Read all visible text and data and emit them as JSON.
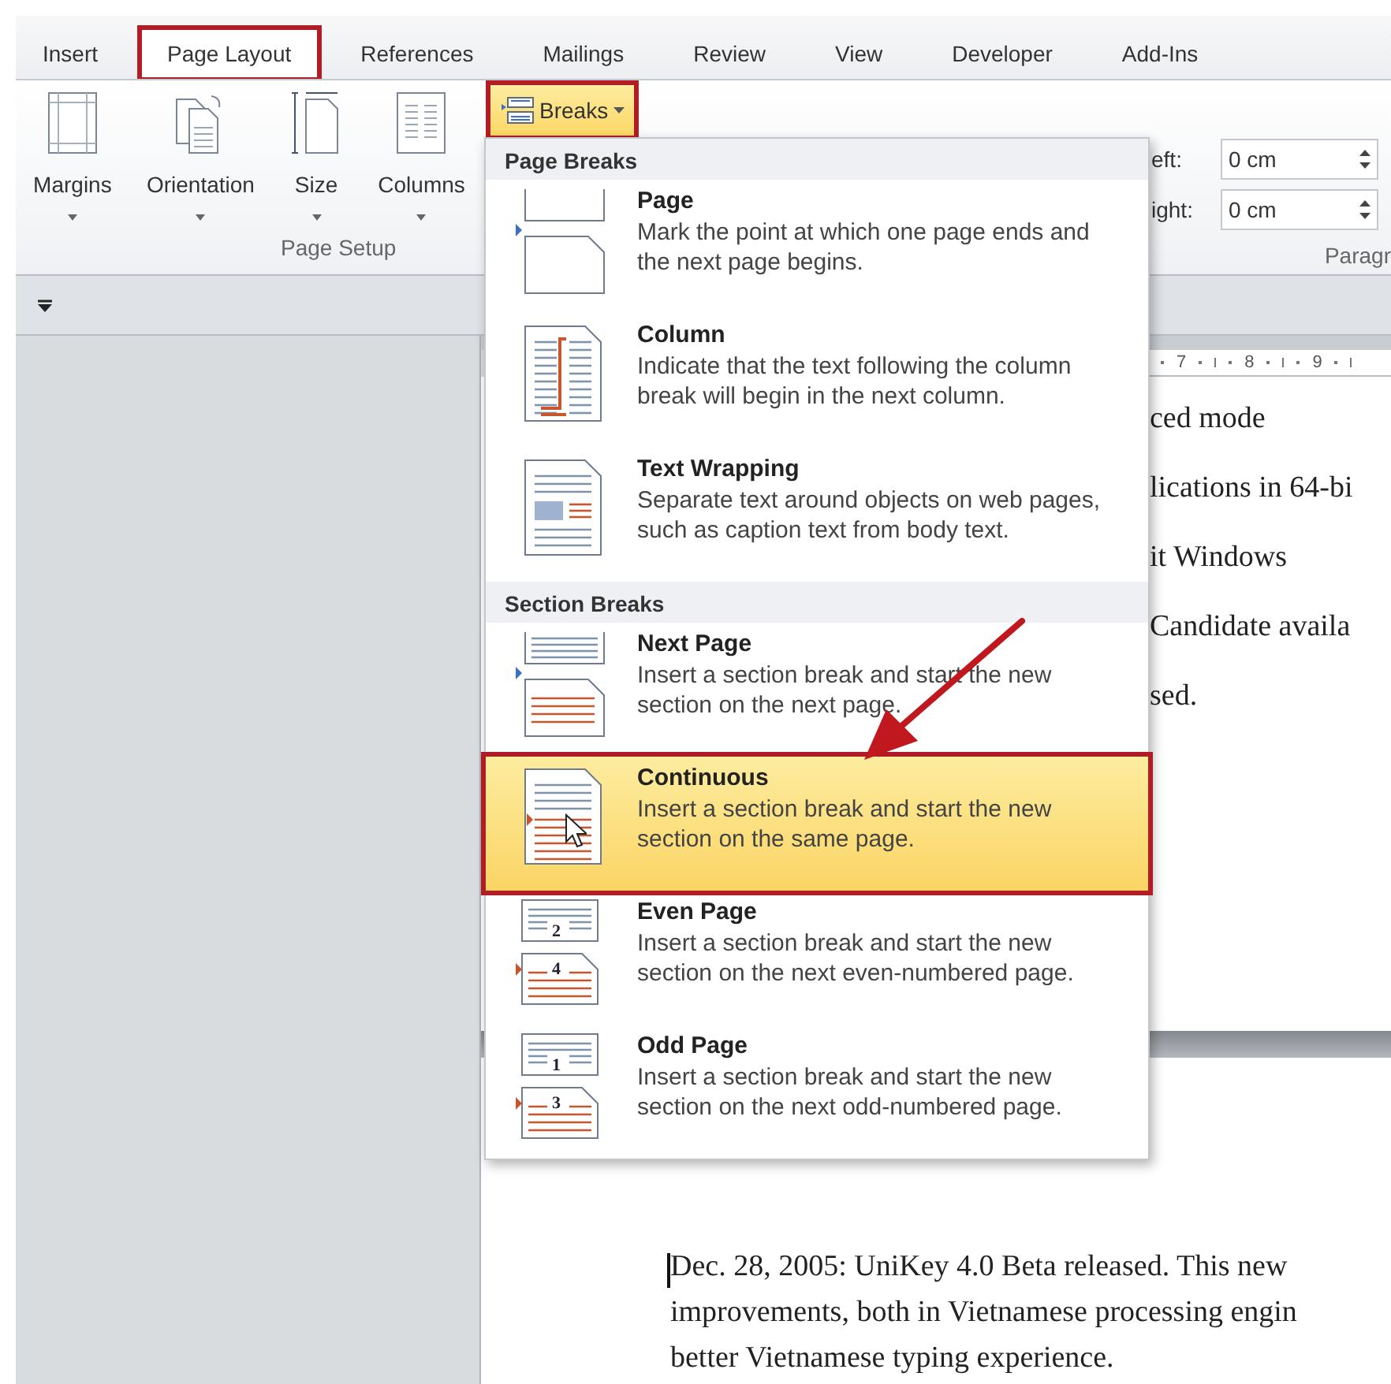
{
  "tabs": [
    {
      "label": "Insert",
      "selected": false,
      "highlighted": false
    },
    {
      "label": "Page Layout",
      "selected": true,
      "highlighted": true
    },
    {
      "label": "References",
      "selected": false,
      "highlighted": false
    },
    {
      "label": "Mailings",
      "selected": false,
      "highlighted": false
    },
    {
      "label": "Review",
      "selected": false,
      "highlighted": false
    },
    {
      "label": "View",
      "selected": false,
      "highlighted": false
    },
    {
      "label": "Developer",
      "selected": false,
      "highlighted": false
    },
    {
      "label": "Add-Ins",
      "selected": false,
      "highlighted": false
    }
  ],
  "ribbon": {
    "page_setup": {
      "buttons": [
        {
          "label": "Margins",
          "kind": "margins"
        },
        {
          "label": "Orientation",
          "kind": "orientation"
        },
        {
          "label": "Size",
          "kind": "size"
        },
        {
          "label": "Columns",
          "kind": "columns"
        }
      ],
      "breaks_button": {
        "label": "Breaks",
        "expanded": true,
        "highlighted": true
      },
      "group_label": "Page Setup"
    },
    "paragraph": {
      "indents": [
        {
          "label": "eft:",
          "value": "0 cm"
        },
        {
          "label": "ight:",
          "value": "0 cm"
        }
      ],
      "group_label": "Paragr"
    }
  },
  "breaks_menu": {
    "sections": [
      {
        "heading": "Page Breaks",
        "items": [
          {
            "kind": "page",
            "title": "Page",
            "description": "Mark the point at which one page ends and the next page begins.",
            "selected": false,
            "highlighted": false
          },
          {
            "kind": "column",
            "title": "Column",
            "description": "Indicate that the text following the column break will begin in the next column.",
            "selected": false,
            "highlighted": false
          },
          {
            "kind": "text-wrapping",
            "title": "Text Wrapping",
            "description": "Separate text around objects on web pages, such as caption text from body text.",
            "selected": false,
            "highlighted": false
          }
        ]
      },
      {
        "heading": "Section Breaks",
        "items": [
          {
            "kind": "next-page",
            "title": "Next Page",
            "description": "Insert a section break and start the new section on the next page.",
            "selected": false,
            "highlighted": false
          },
          {
            "kind": "continuous",
            "title": "Continuous",
            "description": "Insert a section break and start the new section on the same page.",
            "selected": true,
            "highlighted": true
          },
          {
            "kind": "even-page",
            "title": "Even Page",
            "description": "Insert a section break and start the new section on the next even-numbered page.",
            "icon_labels": [
              "2",
              "4"
            ],
            "selected": false,
            "highlighted": false
          },
          {
            "kind": "odd-page",
            "title": "Odd Page",
            "description": "Insert a section break and start the new section on the next odd-numbered page.",
            "icon_labels": [
              "1",
              "3"
            ],
            "selected": false,
            "highlighted": false
          }
        ]
      }
    ]
  },
  "ruler": {
    "numbers": [
      "7",
      "8",
      "9"
    ]
  },
  "document": {
    "page_1_lines": [
      "ced mode",
      "lications in 64-bi",
      "it Windows",
      "Candidate availa",
      "sed."
    ],
    "page_2_lines": [
      "Dec. 28, 2005: UniKey 4.0 Beta released. This new",
      "improvements, both in Vietnamese processing engin",
      "better Vietnamese typing experience."
    ]
  }
}
